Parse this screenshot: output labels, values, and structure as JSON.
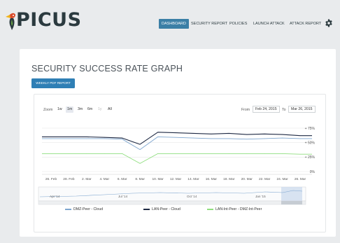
{
  "brand": {
    "name": "PICUS"
  },
  "nav": {
    "items": [
      {
        "label": "DASHBOARD",
        "active": true
      },
      {
        "label": "SECURITY REPORT",
        "active": false
      },
      {
        "label": "POLICIES",
        "active": false
      },
      {
        "label": "LAUNCH ATTACK",
        "active": false
      },
      {
        "label": "ATTACK REPORT",
        "active": false
      }
    ],
    "settings_icon": "gear-icon"
  },
  "page": {
    "title": "SECURITY SUCCESS RATE GRAPH",
    "report_button": "WEEKLY PDF REPORT"
  },
  "range_selector": {
    "zoom_label": "Zoom",
    "buttons": [
      {
        "label": "1w",
        "state": "normal"
      },
      {
        "label": "1m",
        "state": "selected"
      },
      {
        "label": "3m",
        "state": "normal"
      },
      {
        "label": "6m",
        "state": "normal"
      },
      {
        "label": "1y",
        "state": "disabled"
      },
      {
        "label": "All",
        "state": "normal"
      }
    ],
    "from_label": "From",
    "from_value": "Feb 24, 2015",
    "to_label": "To",
    "to_value": "Mar 26, 2015"
  },
  "colors": {
    "dmz_cloud": "#7ea6cf",
    "lan_cloud": "#1f2a44",
    "lan_int_dmz": "#8fde7e",
    "active_nav": "#3b7fa6",
    "button": "#2f7fb5"
  },
  "chart_data": {
    "type": "line",
    "x": [
      "26. Feb",
      "28. Feb",
      "2. Mar",
      "4. Mar",
      "6. Mar",
      "8. Mar",
      "10. Mar",
      "12. Mar",
      "14. Mar",
      "16. Mar",
      "18. Mar",
      "20. Mar",
      "22. Mar",
      "24. Mar",
      "26. Mar"
    ],
    "y_ticks": [
      "0%",
      "+ 25%",
      "+ 50%",
      "+ 75%"
    ],
    "ylim": [
      0,
      75
    ],
    "series": [
      {
        "name": "DMZ-Peer - Cloud",
        "values": [
          57,
          57,
          57,
          57,
          56,
          38,
          60,
          59,
          58,
          57,
          57,
          56,
          57,
          58,
          57
        ]
      },
      {
        "name": "LAN-Peer - Cloud",
        "values": [
          60,
          60,
          60,
          59,
          58,
          47,
          68,
          67,
          66,
          65,
          66,
          64,
          65,
          64,
          62
        ]
      },
      {
        "name": "LAN-Int-Peer - DMZ-Int-Peer",
        "values": [
          31,
          31,
          31,
          31,
          31,
          14,
          31,
          31,
          31,
          31,
          31,
          31,
          31,
          31,
          30
        ]
      }
    ],
    "navigator": {
      "labels": [
        "Apr '14",
        "Jul '14",
        "Oct '14",
        "Jan '15"
      ]
    },
    "legend_position": "bottom"
  }
}
